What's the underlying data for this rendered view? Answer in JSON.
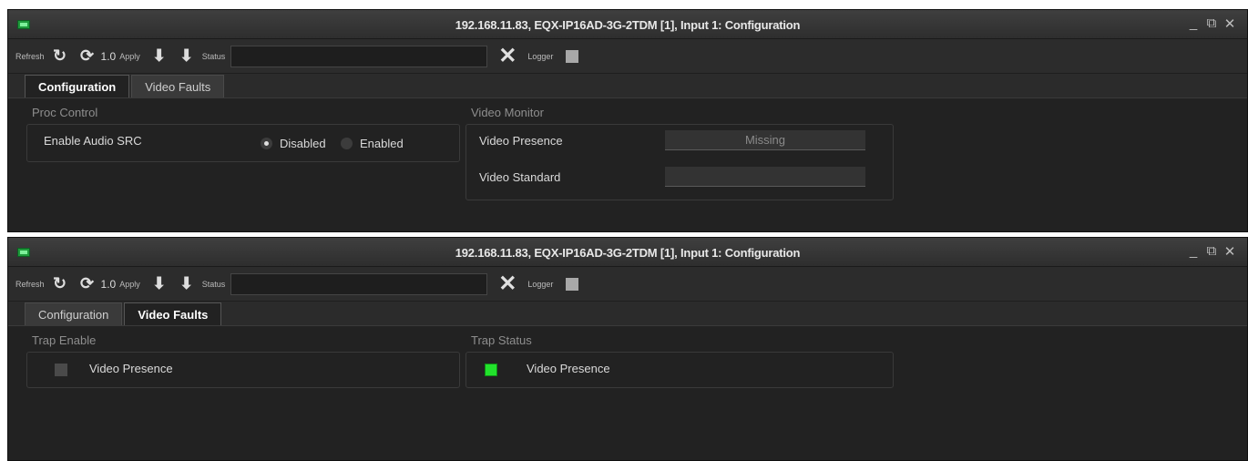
{
  "windows": [
    {
      "title": "192.168.11.83, EQX-IP16AD-3G-2TDM  [1], Input 1: Configuration",
      "toolbar": {
        "refresh_label": "Refresh",
        "version": "1.0",
        "apply_label": "Apply",
        "status_label": "Status",
        "logger_label": "Logger"
      },
      "tabs": [
        "Configuration",
        "Video Faults"
      ],
      "active_tab": "Configuration",
      "proc_control": {
        "title": "Proc Control",
        "enable_audio_src_label": "Enable Audio SRC",
        "option_disabled": "Disabled",
        "option_enabled": "Enabled",
        "selected": "Disabled"
      },
      "video_monitor": {
        "title": "Video Monitor",
        "video_presence_label": "Video Presence",
        "video_presence_value": "Missing",
        "video_standard_label": "Video Standard",
        "video_standard_value": ""
      }
    },
    {
      "title": "192.168.11.83, EQX-IP16AD-3G-2TDM  [1], Input 1: Configuration",
      "toolbar": {
        "refresh_label": "Refresh",
        "version": "1.0",
        "apply_label": "Apply",
        "status_label": "Status",
        "logger_label": "Logger"
      },
      "tabs": [
        "Configuration",
        "Video Faults"
      ],
      "active_tab": "Video Faults",
      "trap_enable": {
        "title": "Trap Enable",
        "video_presence_label": "Video Presence",
        "checked": false
      },
      "trap_status": {
        "title": "Trap Status",
        "video_presence_label": "Video Presence",
        "led_color": "#22e22c"
      }
    }
  ]
}
